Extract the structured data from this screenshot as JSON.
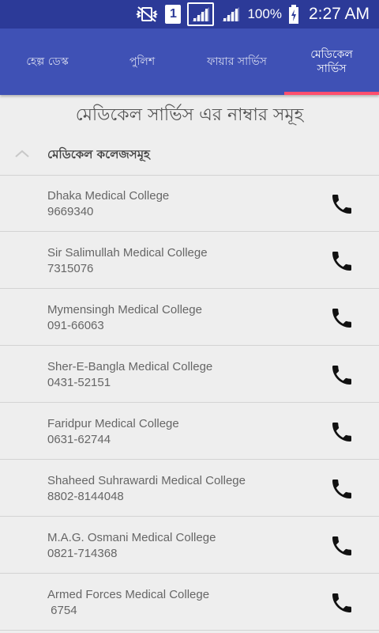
{
  "status_bar": {
    "sim_label": "1",
    "battery_text": "100%",
    "time": "2:27 AM",
    "icons": [
      "vibrate-muted-icon",
      "sim-icon",
      "signal-icon",
      "signal-icon",
      "battery-charging-icon"
    ]
  },
  "tabs": [
    {
      "label": "হেল্প ডেস্ক"
    },
    {
      "label": "পুলিশ"
    },
    {
      "label": "ফায়ার সার্ভিস"
    },
    {
      "label": "মেডিকেল সার্ভিস"
    }
  ],
  "page_title": "মেডিকেল সার্ভিস এর নাম্বার সমূহ",
  "group": {
    "label": "মেডিকেল কলেজসমূহ",
    "icon": "chevron-up-icon"
  },
  "contacts": [
    {
      "name": "Dhaka Medical College",
      "phone": "9669340"
    },
    {
      "name": "Sir Salimullah Medical College",
      "phone": "7315076"
    },
    {
      "name": "Mymensingh Medical College",
      "phone": "091-66063"
    },
    {
      "name": "Sher-E-Bangla Medical College",
      "phone": "0431-52151"
    },
    {
      "name": "Faridpur Medical College",
      "phone": "0631-62744"
    },
    {
      "name": "Shaheed Suhrawardi Medical College",
      "phone": "8802-8144048"
    },
    {
      "name": "M.A.G. Osmani Medical College",
      "phone": "0821-714368"
    },
    {
      "name": "Armed Forces Medical College",
      "phone": " 6754"
    }
  ],
  "colors": {
    "status_bar": "#2c3a98",
    "tab_bar": "#3f51b5",
    "tab_indicator": "#ff4f6e",
    "background": "#eeeeee"
  }
}
